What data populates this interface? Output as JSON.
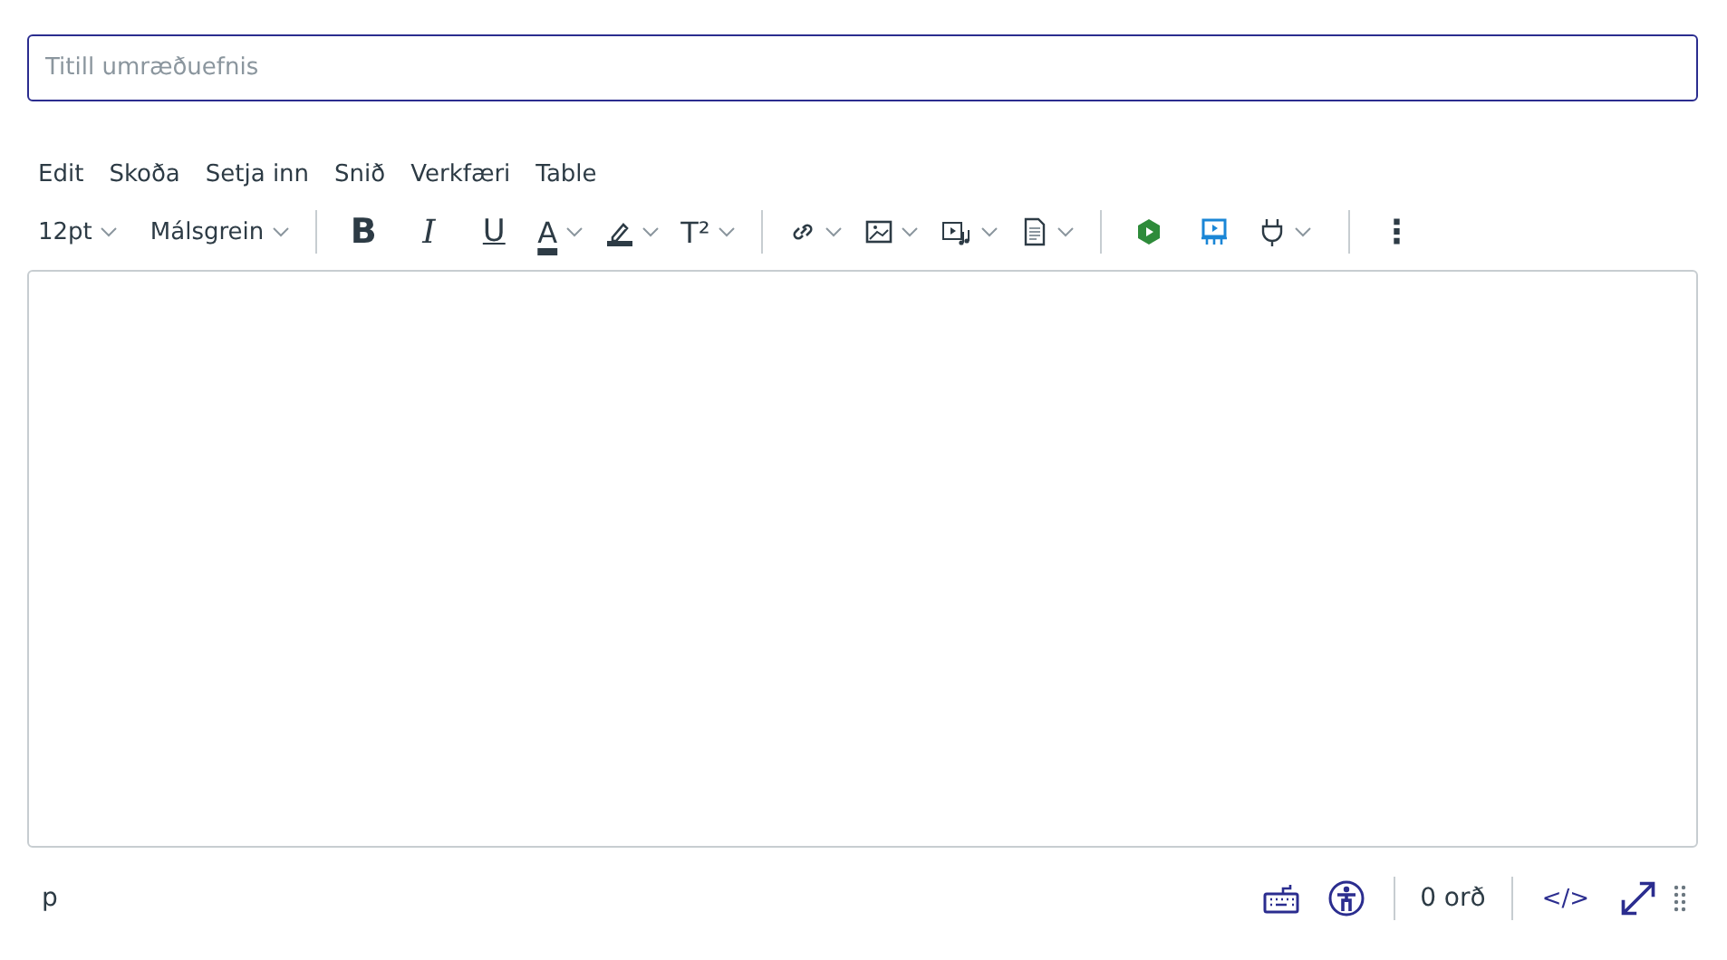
{
  "title_field": {
    "placeholder": "Titill umræðuefnis"
  },
  "menu": [
    "Edit",
    "Skoða",
    "Setja inn",
    "Snið",
    "Verkfæri",
    "Table"
  ],
  "toolbar": {
    "font_size": "12pt",
    "block_format": "Málsgrein",
    "bold": "B",
    "italic": "I",
    "underline": "U",
    "text_color": "A",
    "superscript": "T²",
    "more": "⋮"
  },
  "status_bar": {
    "path": "p",
    "word_count": "0 orð",
    "source": "</>"
  }
}
